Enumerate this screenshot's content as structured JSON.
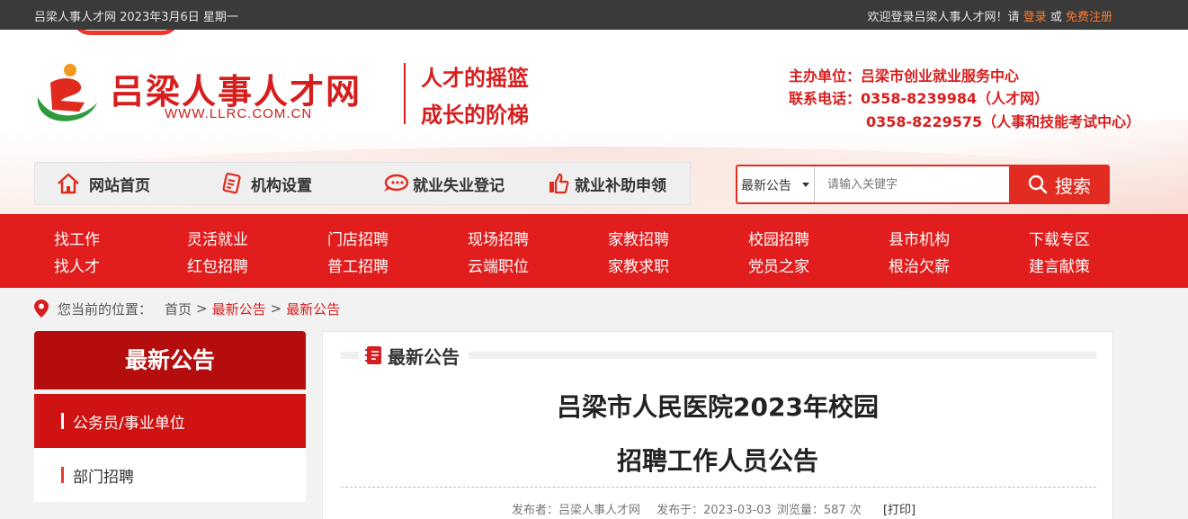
{
  "topbar": {
    "date_text": "吕梁人事人才网 2023年3月6日 星期一",
    "welcome": "欢迎登录吕梁人事人才网！请",
    "login": "登录",
    "or": "或",
    "register": "免费注册"
  },
  "header": {
    "site_title": "吕梁人事人才网",
    "site_url": "WWW.LLRC.COM.CN",
    "slogan_1": "人才的摇篮",
    "slogan_2": "成长的阶梯",
    "host_label": "主办单位：吕梁市创业就业服务中心",
    "phone_label": "联系电话：0358-8239984（人才网）",
    "phone_2": "0358-8229575（人事和技能考试中心）"
  },
  "quicknav": [
    {
      "label": "网站首页",
      "icon": "home-icon"
    },
    {
      "label": "机构设置",
      "icon": "document-icon"
    },
    {
      "label": "就业失业登记",
      "icon": "chat-icon"
    },
    {
      "label": "就业补助申领",
      "icon": "thumbs-up-icon"
    }
  ],
  "search": {
    "category": "最新公告",
    "placeholder": "请输入关键字",
    "button": "搜索"
  },
  "catnav": [
    [
      "找工作",
      "找人才"
    ],
    [
      "灵活就业",
      "红包招聘"
    ],
    [
      "门店招聘",
      "普工招聘"
    ],
    [
      "现场招聘",
      "云端职位"
    ],
    [
      "家教招聘",
      "家教求职"
    ],
    [
      "校园招聘",
      "党员之家"
    ],
    [
      "县市机构",
      "根治欠薪"
    ],
    [
      "下载专区",
      "建言献策"
    ]
  ],
  "breadcrumb": {
    "label": "您当前的位置：",
    "home": "首页",
    "sep": ">",
    "level1": "最新公告",
    "level2": "最新公告"
  },
  "sidebar": {
    "title": "最新公告",
    "items": [
      "公务员/事业单位",
      "部门招聘"
    ]
  },
  "article": {
    "section": "最新公告",
    "title_line1": "吕梁市人民医院2023年校园",
    "title_line2": "招聘工作人员公告",
    "publisher": "发布者：吕梁人事人才网",
    "published": "发布于：2023-03-03",
    "views": "浏览量：587 次",
    "print": "[打印]"
  },
  "colors": {
    "brand_red": "#d71e1e",
    "nav_red": "#e11d1d",
    "sidebar_dark_red": "#b50d0d",
    "topbar_bg": "#3a3a3a",
    "link_orange": "#ff7a2e"
  }
}
